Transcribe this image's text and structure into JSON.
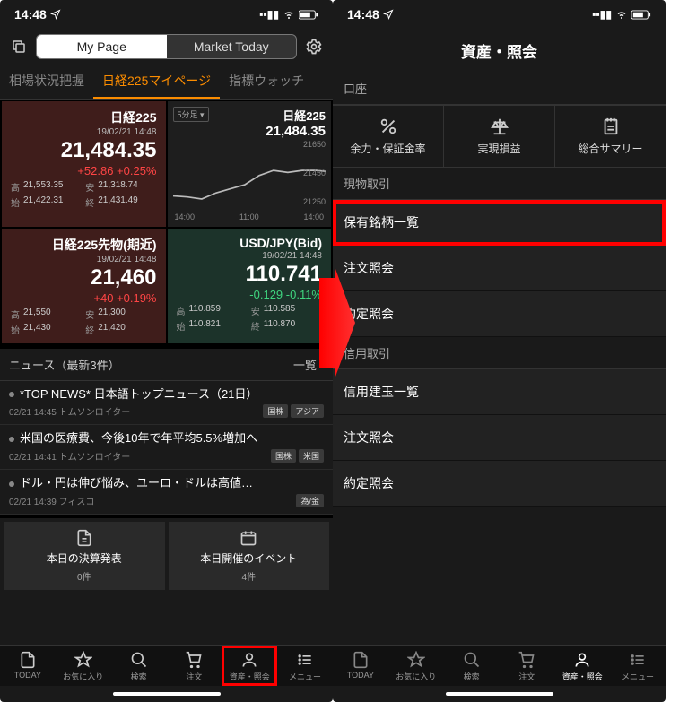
{
  "status": {
    "time": "14:48",
    "nav_icon": "✈︎-like",
    "signal": "••ll",
    "wifi": "wifi",
    "battery": "batt"
  },
  "left": {
    "seg": {
      "mypage": "My Page",
      "market": "Market Today"
    },
    "tabs": {
      "t1": "相場状況把握",
      "t2": "日経225マイページ",
      "t3": "指標ウォッチ"
    },
    "card1": {
      "title": "日経225",
      "time": "19/02/21 14:48",
      "price": "21,484.35",
      "change": "+52.86 +0.25%",
      "hi_l": "高",
      "hi": "21,553.35",
      "lo_l": "安",
      "lo": "21,318.74",
      "op_l": "始",
      "op": "21,422.31",
      "cl_l": "終",
      "cl": "21,431.49"
    },
    "card2_chart": {
      "dd": "5分足 ▾",
      "title": "日経225",
      "price": "21,484.35",
      "y1": "21650",
      "y2": "21450",
      "y3": "21250",
      "x1": "14:00",
      "x2": "11:00",
      "x3": "14:00"
    },
    "card3": {
      "title": "日経225先物(期近)",
      "time": "19/02/21 14:48",
      "price": "21,460",
      "change": "+40 +0.19%",
      "hi_l": "高",
      "hi": "21,550",
      "lo_l": "安",
      "lo": "21,300",
      "op_l": "始",
      "op": "21,430",
      "cl_l": "終",
      "cl": "21,420"
    },
    "card4": {
      "title": "USD/JPY(Bid)",
      "time": "19/02/21 14:48",
      "price": "110.741",
      "change": "-0.129 -0.11%",
      "hi_l": "高",
      "hi": "110.859",
      "lo_l": "安",
      "lo": "110.585",
      "op_l": "始",
      "op": "110.821",
      "cl_l": "終",
      "cl": "110.870"
    },
    "news": {
      "header": "ニュース（最新3件）",
      "all": "一覧 ›",
      "items": [
        {
          "h": "*TOP NEWS* 日本語トップニュース（21日）",
          "ts": "02/21 14:45 トムソンロイター",
          "tags": [
            "国株",
            "アジア"
          ]
        },
        {
          "h": "米国の医療費、今後10年で年平均5.5%増加へ",
          "ts": "02/21 14:41 トムソンロイター",
          "tags": [
            "国株",
            "米国"
          ]
        },
        {
          "h": "ドル・円は伸び悩み、ユーロ・ドルは高値…",
          "ts": "02/21 14:39 フィスコ",
          "tags": [
            "為/金"
          ]
        }
      ]
    },
    "shortcuts": {
      "s1": "本日の決算発表",
      "s1c": "0件",
      "s2": "本日開催のイベント",
      "s2c": "4件"
    },
    "nav": {
      "today": "TODAY",
      "fav": "お気に入り",
      "search": "検索",
      "order": "注文",
      "asset": "資産・照会",
      "menu": "メニュー"
    }
  },
  "right": {
    "title": "資産・照会",
    "section_account": "口座",
    "btns": {
      "b1": "余力・保証金率",
      "b2": "実現損益",
      "b3": "総合サマリー"
    },
    "section_spot": "現物取引",
    "spot_rows": {
      "r1": "保有銘柄一覧",
      "r2": "注文照会",
      "r3": "約定照会"
    },
    "section_margin": "信用取引",
    "margin_rows": {
      "r1": "信用建玉一覧",
      "r2": "注文照会",
      "r3": "約定照会"
    }
  },
  "chart_data": {
    "type": "line",
    "title": "日経225 5分足",
    "ylim": [
      21250,
      21650
    ],
    "x": [
      "14:00",
      "11:00",
      "14:00"
    ],
    "values_approx": [
      21300,
      21310,
      21290,
      21350,
      21400,
      21440,
      21500,
      21480,
      21490,
      21484
    ],
    "note": "approximate intraday 5-minute line read from mini-chart"
  }
}
